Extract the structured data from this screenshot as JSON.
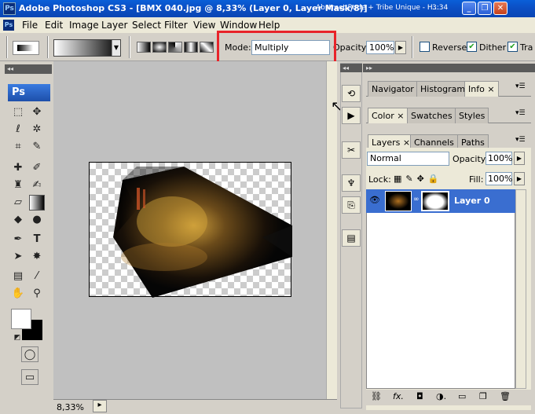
{
  "titlebar": {
    "app_icon": "Ps",
    "title": "Adobe Photoshop CS3 - [BMX 040.jpg @ 8,33% (Layer 0, Layer Mask/8)]",
    "extra": "Abstract Rude + Tribe Unique - H...",
    "clock": "3:34",
    "minimize": "_",
    "restore": "❐",
    "close": "✕"
  },
  "menu": {
    "icon": "Ps",
    "items": [
      "File",
      "Edit",
      "Image",
      "Layer",
      "Select",
      "Filter",
      "View",
      "Window",
      "Help"
    ]
  },
  "options": {
    "mode_label": "Mode:",
    "mode_value": "Multiply",
    "opacity_label": "Opacity:",
    "opacity_value": "100%",
    "reverse_label": "Reverse",
    "dither_label": "Dither",
    "transparency_label": "Tra",
    "reverse_checked": false,
    "dither_checked": true,
    "transparency_checked": true
  },
  "toolbox": {
    "logo": "Ps",
    "strip": "◂◂"
  },
  "status": {
    "zoom": "8,33%",
    "arrow": "▸"
  },
  "dock": {
    "strip": "◂◂"
  },
  "panels": {
    "strip": "▸▸",
    "group1_tabs": [
      "Navigator",
      "Histogram",
      "Info"
    ],
    "group2_tabs": [
      "Color",
      "Swatches",
      "Styles"
    ],
    "group3_tabs": [
      "Layers",
      "Channels",
      "Paths"
    ],
    "blend_mode": "Normal",
    "layers_opacity_label": "Opacity:",
    "layers_opacity_value": "100%",
    "lock_label": "Lock:",
    "fill_label": "Fill:",
    "fill_value": "100%",
    "layer_name": "Layer 0",
    "bottom_icons": [
      "link-icon",
      "fx-icon",
      "mask-icon",
      "adjustment-icon",
      "folder-icon",
      "new-layer-icon",
      "trash-icon"
    ]
  },
  "colors": {
    "title_blue": "#0b4fc4",
    "highlight_red": "#e8242a",
    "layer_selected": "#3a6ed0"
  }
}
